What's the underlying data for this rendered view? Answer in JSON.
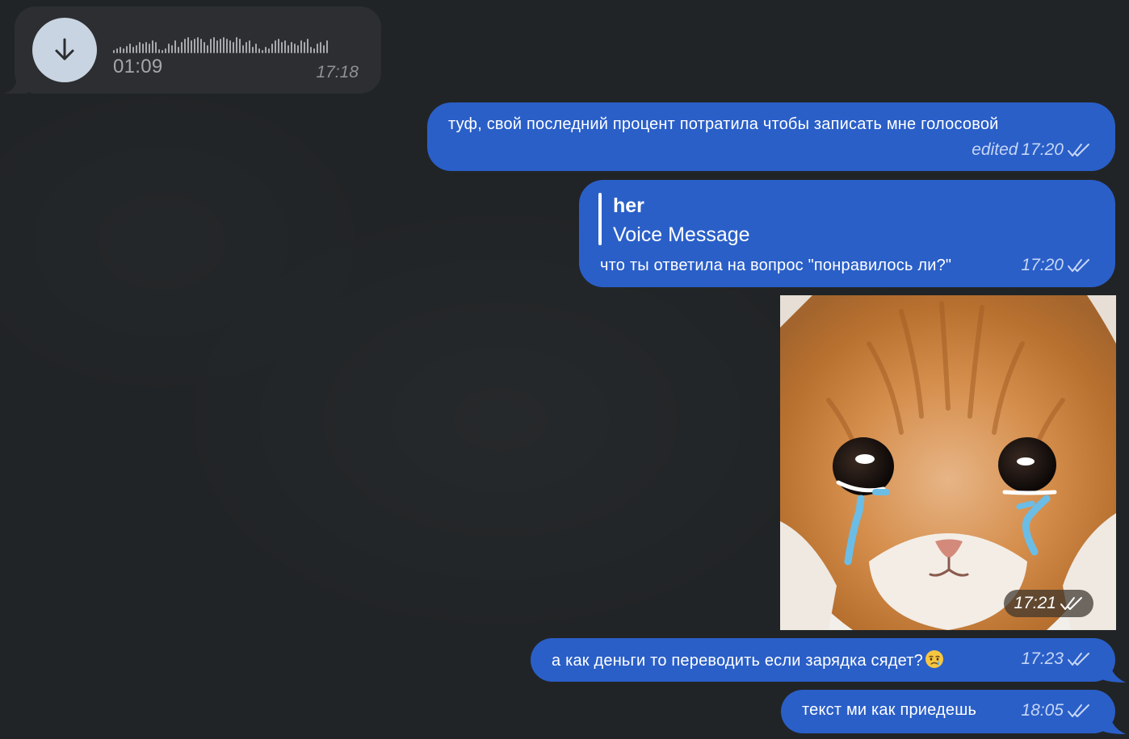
{
  "chat": {
    "messages": [
      {
        "kind": "voice",
        "direction": "incoming",
        "duration": "01:09",
        "time": "17:18",
        "icon": "download-icon",
        "waveform_levels": [
          4,
          6,
          8,
          6,
          9,
          12,
          8,
          10,
          14,
          12,
          14,
          12,
          16,
          14,
          5,
          4,
          6,
          12,
          10,
          16,
          8,
          14,
          18,
          20,
          16,
          18,
          20,
          18,
          14,
          10,
          18,
          20,
          16,
          18,
          20,
          18,
          16,
          14,
          20,
          18,
          10,
          14,
          16,
          8,
          12,
          6,
          4,
          8,
          6,
          12,
          16,
          18,
          14,
          16,
          10,
          14,
          12,
          10,
          16,
          14,
          18,
          8,
          6,
          12,
          14,
          10,
          16
        ]
      },
      {
        "kind": "text",
        "direction": "outgoing",
        "text": "туф, свой последний процент потратила чтобы записать мне голосовой",
        "edited_label": "edited",
        "time": "17:20",
        "status": "read"
      },
      {
        "kind": "reply",
        "direction": "outgoing",
        "reply_to_author": "her",
        "reply_to_preview": "Voice Message",
        "text": "что ты ответила на вопрос \"понравилось ли?\"",
        "time": "17:20",
        "status": "read"
      },
      {
        "kind": "photo",
        "direction": "outgoing",
        "description_icon": "crying-kitten-photo",
        "time": "17:21",
        "status": "read"
      },
      {
        "kind": "text",
        "direction": "outgoing",
        "text": "а как деньги то переводить если зарядка сядет?",
        "emoji": "crying-face-emoji",
        "time": "17:23",
        "status": "read"
      },
      {
        "kind": "text",
        "direction": "outgoing",
        "text": "текст ми как приедешь",
        "time": "18:05",
        "status": "read"
      }
    ]
  },
  "colors": {
    "background": "#212426",
    "incoming_bubble": "#2c2e31",
    "outgoing_bubble": "#2a5fc8",
    "meta_text": "#c7d6f4"
  }
}
